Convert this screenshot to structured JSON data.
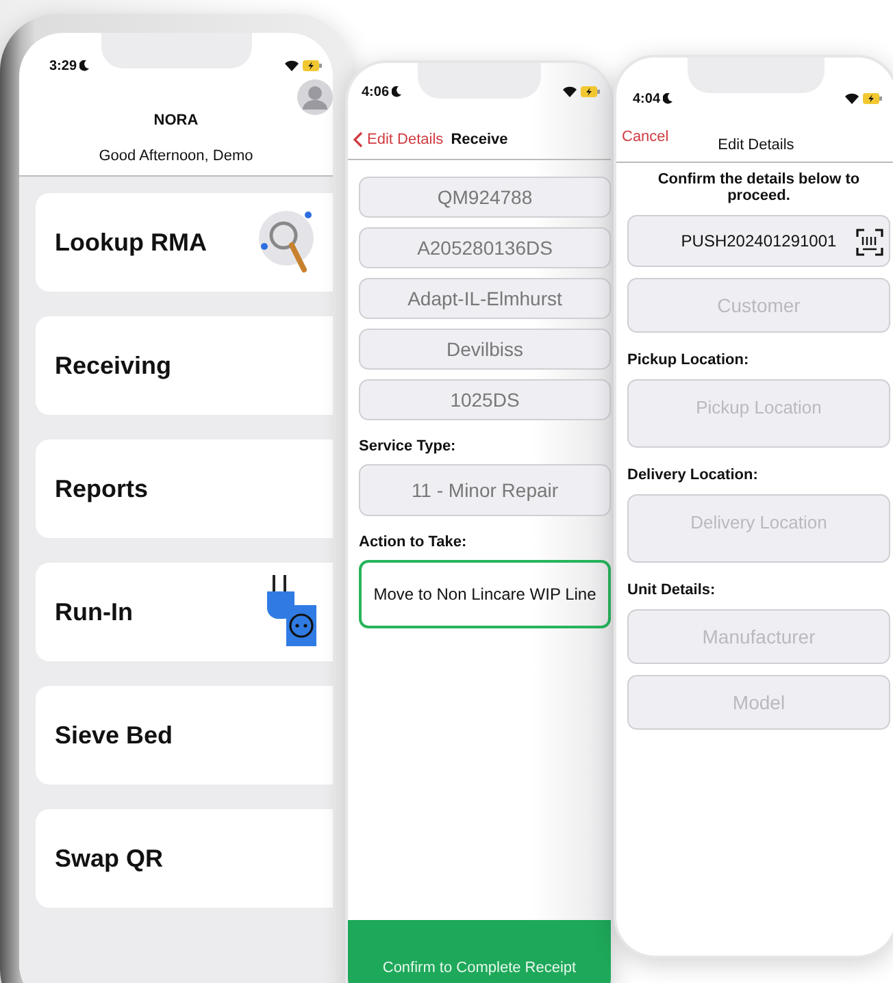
{
  "home": {
    "time": "3:29",
    "title": "NORA",
    "greeting": "Good Afternoon, Demo",
    "items": [
      {
        "label": "Lookup RMA",
        "kind": "magnifier"
      },
      {
        "label": "Receiving",
        "kind": "plain"
      },
      {
        "label": "Reports",
        "kind": "plain"
      },
      {
        "label": "Run-In",
        "kind": "plug"
      },
      {
        "label": "Sieve Bed",
        "kind": "plain"
      },
      {
        "label": "Swap QR",
        "kind": "plain"
      }
    ]
  },
  "receive": {
    "time": "4:06",
    "back": "Edit Details",
    "title": "Receive",
    "fields": [
      "QM924788",
      "A205280136DS",
      "Adapt-IL-Elmhurst",
      "Devilbiss",
      "1025DS"
    ],
    "service_label": "Service Type:",
    "service_value": "11 - Minor Repair",
    "action_label": "Action to Take:",
    "action_value": "Move to Non Lincare WIP Line",
    "confirm": "Confirm to Complete Receipt"
  },
  "edit": {
    "time": "4:04",
    "cancel": "Cancel",
    "title": "Edit Details",
    "instruction": "Confirm the details below to proceed.",
    "rows": [
      {
        "kind": "scan",
        "value": "PUSH202401291001"
      },
      {
        "kind": "field",
        "placeholder": "Customer"
      },
      {
        "kind": "label",
        "text": "Pickup Location:"
      },
      {
        "kind": "area",
        "placeholder": "Pickup Location"
      },
      {
        "kind": "label",
        "text": "Delivery Location:"
      },
      {
        "kind": "area",
        "placeholder": "Delivery Location"
      },
      {
        "kind": "label",
        "text": "Unit Details:"
      },
      {
        "kind": "field",
        "placeholder": "Manufacturer"
      },
      {
        "kind": "field",
        "placeholder": "Model"
      }
    ]
  }
}
